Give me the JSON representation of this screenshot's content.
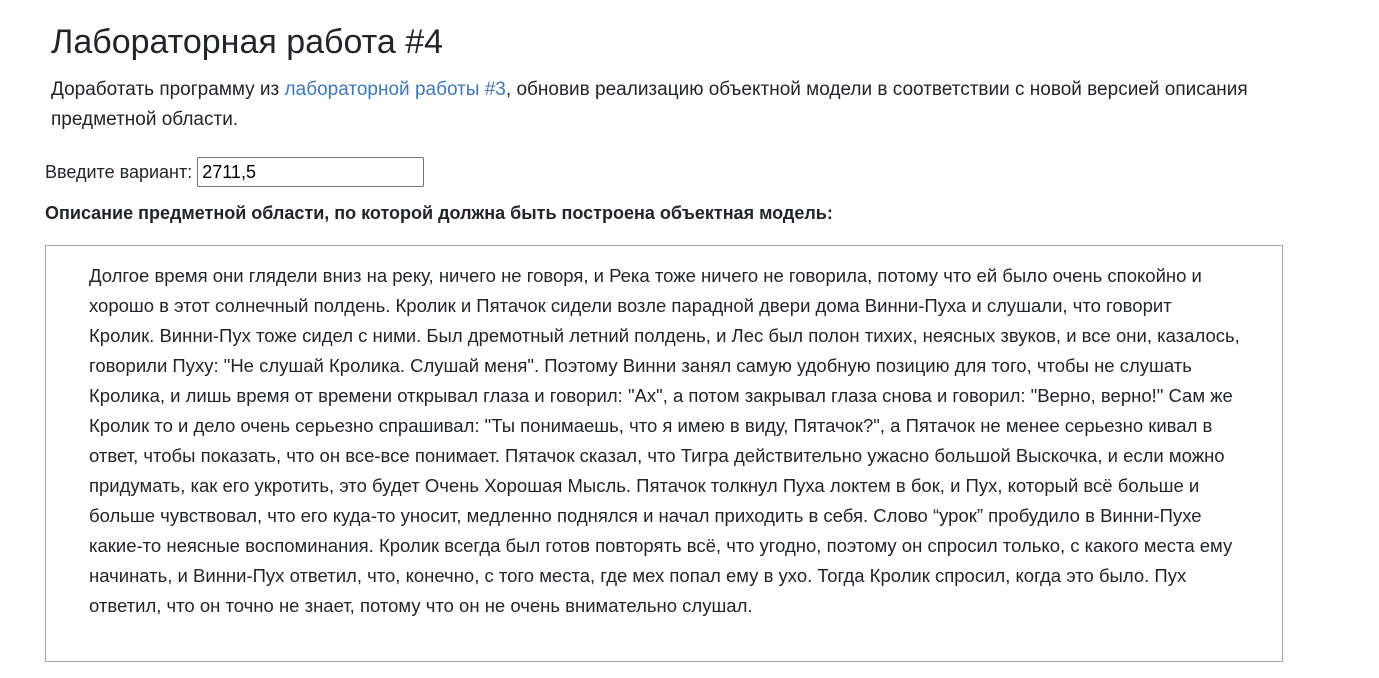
{
  "page": {
    "title": "Лабораторная работа #4",
    "intro": {
      "before_link": "Доработать программу из ",
      "link_text": "лабораторной работы #3",
      "after_link": ", обновив реализацию объектной модели в соответствии с новой версией описания предметной области."
    },
    "variant": {
      "label": "Введите вариант:",
      "value": "2711,5"
    },
    "subject_heading": "Описание предметной области, по которой должна быть построена объектная модель:",
    "description": "Долгое время они глядели вниз на реку, ничего не говоря, и Река тоже ничего не говорила, потому что ей было очень спокойно и хорошо в этот солнечный полдень. Кролик и Пятачок сидели возле парадной двери дома Винни-Пуха и слушали, что говорит Кролик. Винни-Пух тоже сидел с ними. Был дремотный летний полдень, и Лес был полон тихих, неясных звуков, и все они, казалось, говорили Пуху: \"Не слушай Кролика. Слушай меня\". Поэтому Винни занял самую удобную позицию для того, чтобы не слушать Кролика, и лишь время от времени открывал глаза и говорил: \"Ах\", а потом закрывал глаза снова и говорил: \"Верно, верно!\" Сам же Кролик то и дело очень серьезно спрашивал: \"Ты понимаешь, что я имею в виду, Пятачок?\", а Пятачок не менее серьезно кивал в ответ, чтобы показать, что он все-все понимает. Пятачок сказал, что Тигра действительно ужасно большой Выскочка, и если можно придумать, как его укротить, это будет Очень Хорошая Мысль. Пятачок толкнул Пуха локтем в бок, и Пух, который всё больше и больше чувствовал, что его куда-то уносит, медленно поднялся и начал приходить в себя. Слово “урок” пробудило в Винни-Пухе какие-то неясные воспоминания. Кролик всегда был готов повторять всё, что угодно, поэтому он спросил только, с какого места ему начинать, и Винни-Пух ответил, что, конечно, с того места, где мех попал ему в ухо. Тогда Кролик спросил, когда это было. Пух ответил, что он точно не знает, потому что он не очень внимательно слушал."
  },
  "colors": {
    "link": "#3f76b4",
    "text": "#212529",
    "box_border": "#a8a8a8"
  }
}
